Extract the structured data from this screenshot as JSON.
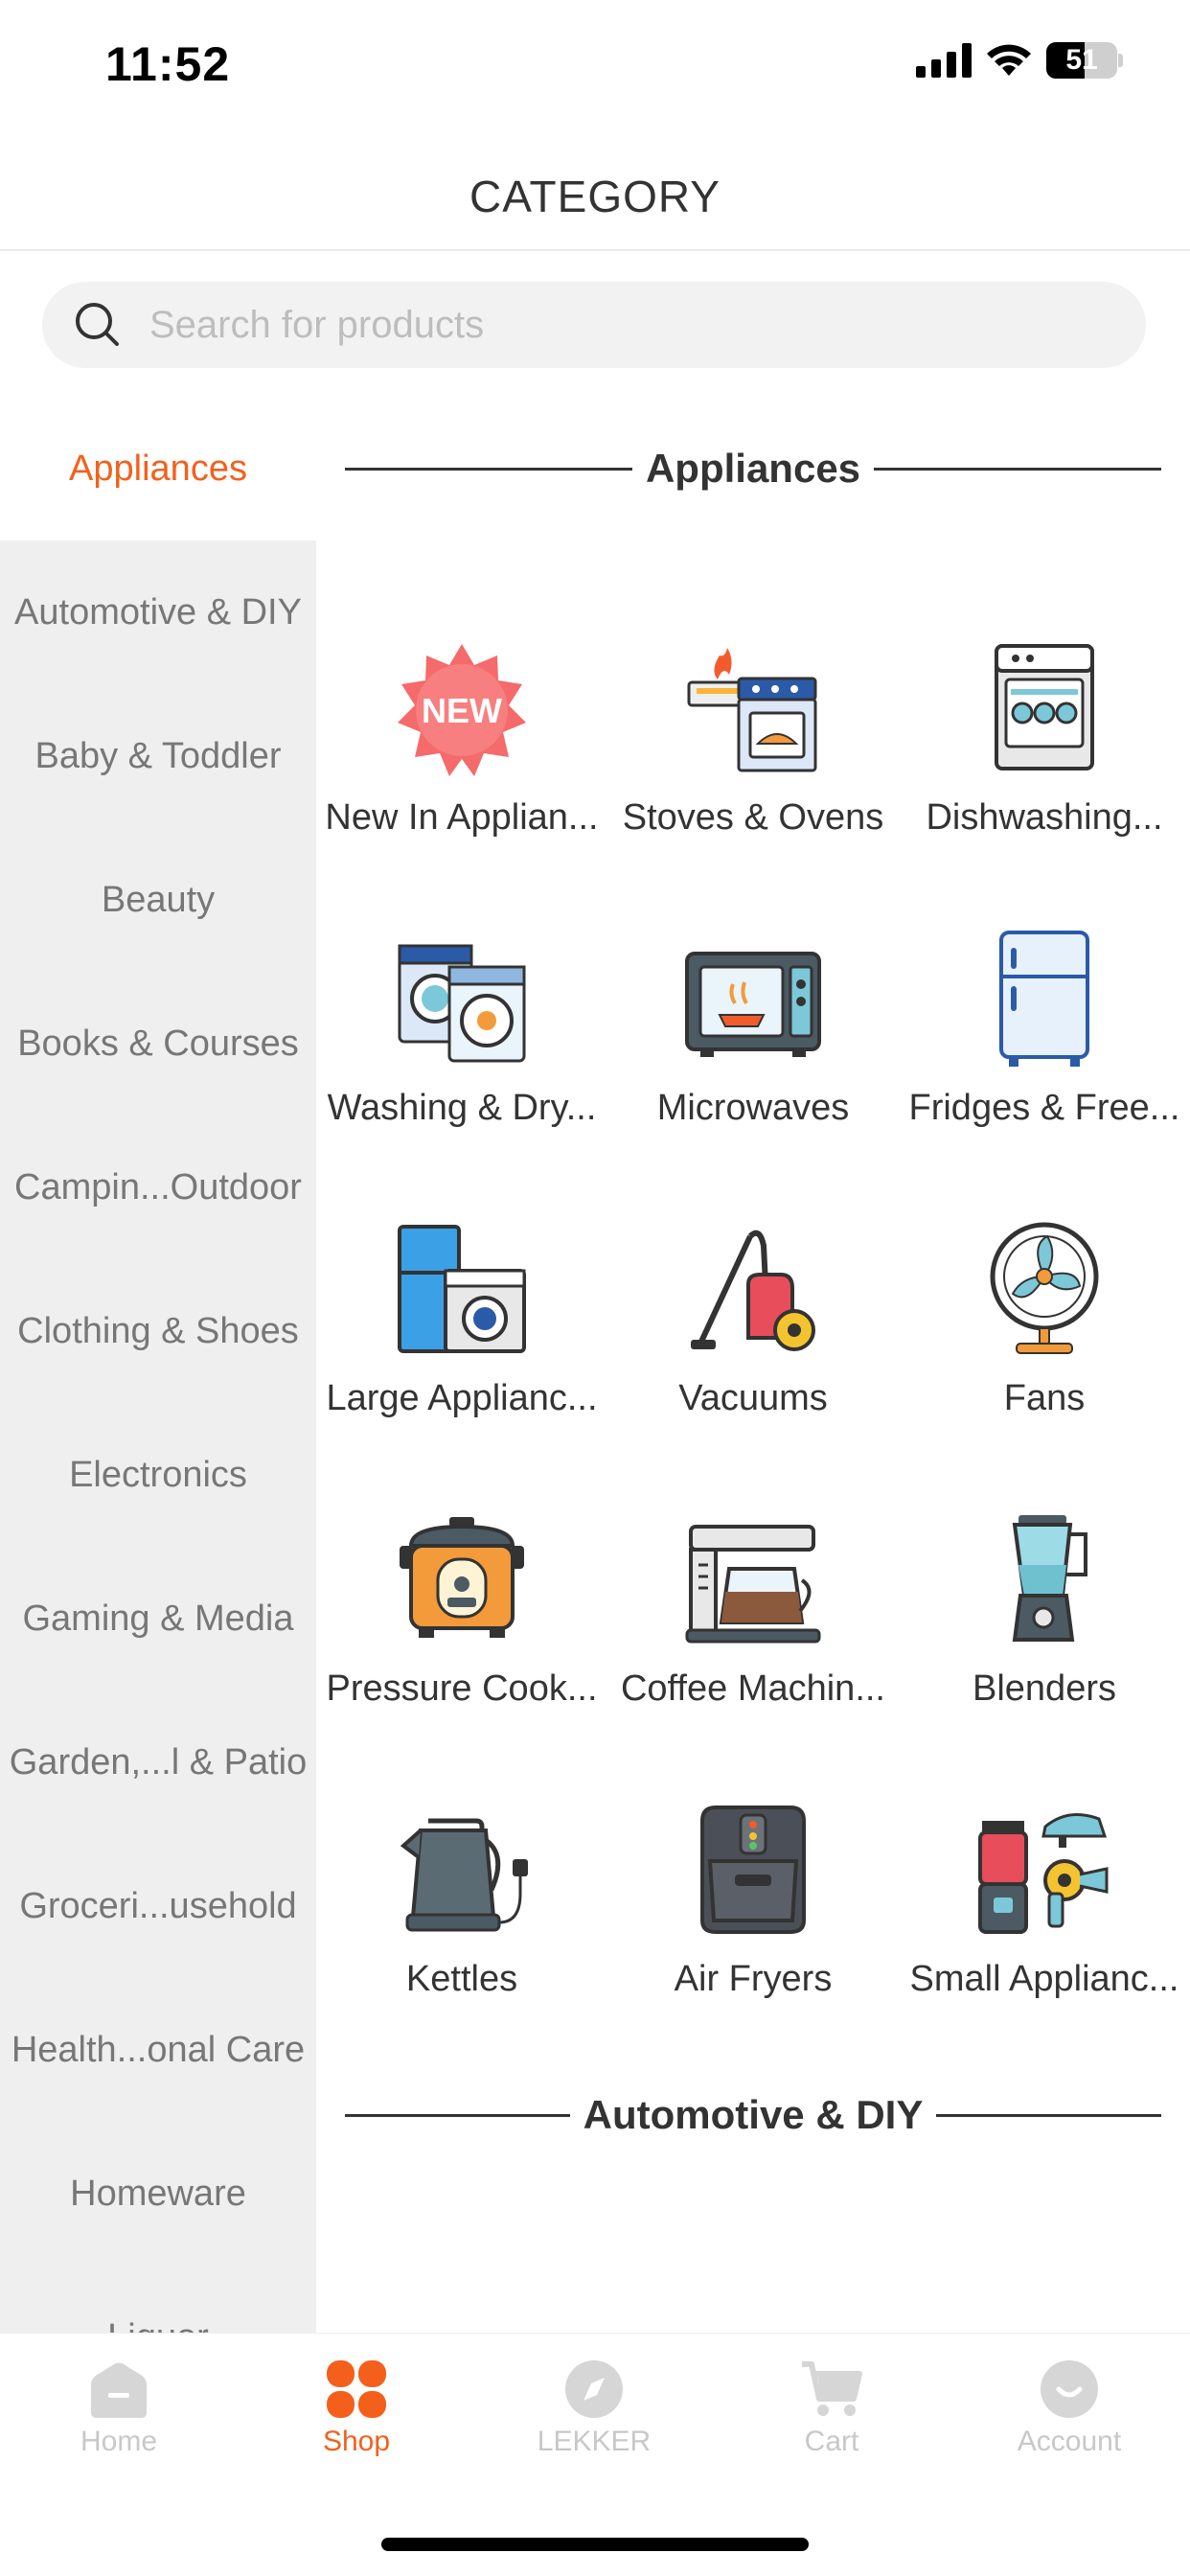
{
  "status_bar": {
    "time": "11:52",
    "battery": "51",
    "icons": [
      "signal-icon",
      "wifi-icon",
      "battery-icon"
    ]
  },
  "header": {
    "title": "CATEGORY"
  },
  "search": {
    "placeholder": "Search for products",
    "value": ""
  },
  "colors": {
    "accent": "#f4601c",
    "sidebar_bg": "#efefef",
    "text": "#333333",
    "muted": "#777777"
  },
  "sidebar": {
    "active": "Appliances",
    "items": [
      "Automotive & DIY",
      "Baby & Toddler",
      "Beauty",
      "Books & Courses",
      "Campin...Outdoor",
      "Clothing & Shoes",
      "Electronics",
      "Gaming & Media",
      "Garden,...l & Patio",
      "Groceri...usehold",
      "Health...onal Care",
      "Homeware",
      "Liquor"
    ]
  },
  "sections": [
    {
      "title": "Appliances",
      "items": [
        {
          "label": "New In Applian...",
          "icon": "new-badge-icon"
        },
        {
          "label": "Stoves & Ovens",
          "icon": "stove-oven-icon"
        },
        {
          "label": "Dishwashing...",
          "icon": "dishwasher-icon"
        },
        {
          "label": "Washing & Dry...",
          "icon": "washing-machine-icon"
        },
        {
          "label": "Microwaves",
          "icon": "microwave-icon"
        },
        {
          "label": "Fridges & Free...",
          "icon": "fridge-icon"
        },
        {
          "label": "Large Applianc...",
          "icon": "large-appliances-icon"
        },
        {
          "label": "Vacuums",
          "icon": "vacuum-icon"
        },
        {
          "label": "Fans",
          "icon": "fan-icon"
        },
        {
          "label": "Pressure Cook...",
          "icon": "pressure-cooker-icon"
        },
        {
          "label": "Coffee Machin...",
          "icon": "coffee-machine-icon"
        },
        {
          "label": "Blenders",
          "icon": "blender-icon"
        },
        {
          "label": "Kettles",
          "icon": "kettle-icon"
        },
        {
          "label": "Air Fryers",
          "icon": "air-fryer-icon"
        },
        {
          "label": "Small Applianc...",
          "icon": "small-appliances-icon"
        }
      ]
    },
    {
      "title": "Automotive & DIY",
      "items": []
    }
  ],
  "tabbar": {
    "active": "Shop",
    "tabs": [
      {
        "label": "Home",
        "icon": "home-icon"
      },
      {
        "label": "Shop",
        "icon": "shop-grid-icon"
      },
      {
        "label": "LEKKER",
        "icon": "compass-icon"
      },
      {
        "label": "Cart",
        "icon": "cart-icon"
      },
      {
        "label": "Account",
        "icon": "account-icon"
      }
    ]
  }
}
